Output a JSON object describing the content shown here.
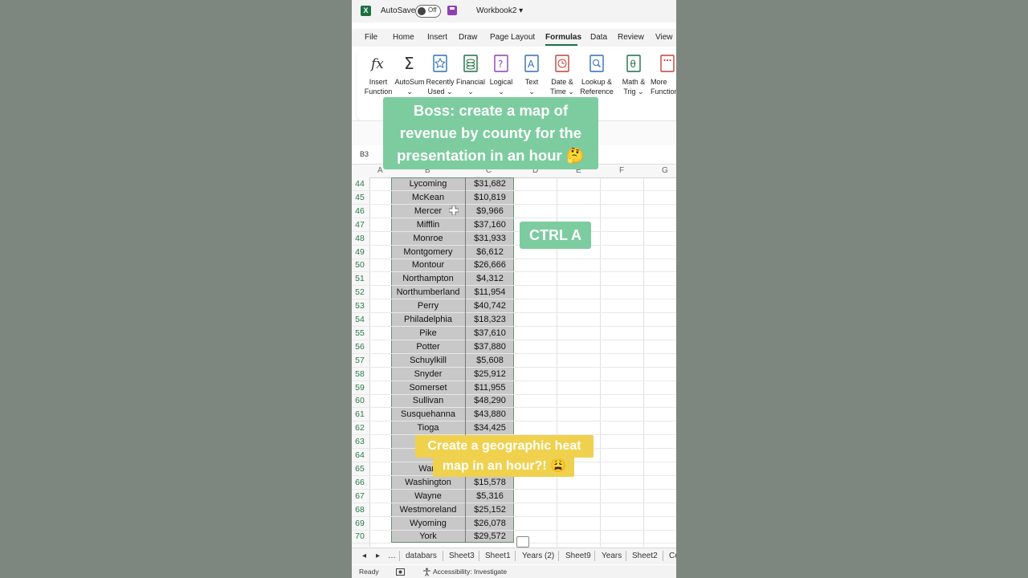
{
  "titlebar": {
    "logo": "X",
    "autosave_label": "AutoSave",
    "autosave_state": "Off",
    "workbook": "Workbook2 ▾"
  },
  "menu": [
    "File",
    "Home",
    "Insert",
    "Draw",
    "Page Layout",
    "Formulas",
    "Data",
    "Review",
    "View"
  ],
  "active_menu": "Formulas",
  "ribbon": {
    "insert_function": "Insert\nFunction",
    "autosum": "AutoSum\n⌄",
    "recently_used": "Recently\nUsed ⌄",
    "financial": "Financial\n⌄",
    "logical": "Logical\n⌄",
    "text": "Text\n⌄",
    "date_time": "Date &\nTime ⌄",
    "lookup": "Lookup &\nReference ⌄",
    "math_trig": "Math &\nTrig ⌄",
    "more": "More\nFunctions"
  },
  "name_box": "B3",
  "columns": [
    "A",
    "B",
    "C",
    "D",
    "E",
    "F",
    "G"
  ],
  "rows": [
    {
      "num": "44",
      "county": "Lycoming",
      "revenue": "$31,682"
    },
    {
      "num": "45",
      "county": "McKean",
      "revenue": "$10,819"
    },
    {
      "num": "46",
      "county": "Mercer",
      "revenue": "$9,966"
    },
    {
      "num": "47",
      "county": "Mifflin",
      "revenue": "$37,160"
    },
    {
      "num": "48",
      "county": "Monroe",
      "revenue": "$31,933"
    },
    {
      "num": "49",
      "county": "Montgomery",
      "revenue": "$6,612"
    },
    {
      "num": "50",
      "county": "Montour",
      "revenue": "$26,666"
    },
    {
      "num": "51",
      "county": "Northampton",
      "revenue": "$4,312"
    },
    {
      "num": "52",
      "county": "Northumberland",
      "revenue": "$11,954"
    },
    {
      "num": "53",
      "county": "Perry",
      "revenue": "$40,742"
    },
    {
      "num": "54",
      "county": "Philadelphia",
      "revenue": "$18,323"
    },
    {
      "num": "55",
      "county": "Pike",
      "revenue": "$37,610"
    },
    {
      "num": "56",
      "county": "Potter",
      "revenue": "$37,880"
    },
    {
      "num": "57",
      "county": "Schuylkill",
      "revenue": "$5,608"
    },
    {
      "num": "58",
      "county": "Snyder",
      "revenue": "$25,912"
    },
    {
      "num": "59",
      "county": "Somerset",
      "revenue": "$11,955"
    },
    {
      "num": "60",
      "county": "Sullivan",
      "revenue": "$48,290"
    },
    {
      "num": "61",
      "county": "Susquehanna",
      "revenue": "$43,880"
    },
    {
      "num": "62",
      "county": "Tioga",
      "revenue": "$34,425"
    },
    {
      "num": "63",
      "county": "",
      "revenue": ""
    },
    {
      "num": "64",
      "county": "V",
      "revenue": ""
    },
    {
      "num": "65",
      "county": "Warr",
      "revenue": ""
    },
    {
      "num": "66",
      "county": "Washington",
      "revenue": "$15,578"
    },
    {
      "num": "67",
      "county": "Wayne",
      "revenue": "$5,316"
    },
    {
      "num": "68",
      "county": "Westmoreland",
      "revenue": "$25,152"
    },
    {
      "num": "69",
      "county": "Wyoming",
      "revenue": "$26,078"
    },
    {
      "num": "70",
      "county": "York",
      "revenue": "$29,572"
    },
    {
      "num": "71",
      "county": "",
      "revenue": ""
    }
  ],
  "sheet_tabs": [
    "databars",
    "Sheet3",
    "Sheet1",
    "Years (2)",
    "Sheet9",
    "Years",
    "Sheet2",
    "Co"
  ],
  "tab_nav": {
    "prev": "◂",
    "next": "▸",
    "more": "…"
  },
  "status": {
    "ready": "Ready",
    "accessibility": "Accessibility: Investigate"
  },
  "overlays": {
    "boss_caption": "Boss: create a map of\nrevenue by county for the\npresentation in an hour 🤔",
    "ctrl_a": "CTRL A",
    "heat_map_caption": "Create a geographic heat\nmap in an hour?! 😩"
  },
  "colors": {
    "excel_green": "#1d6f42",
    "caption_green": "#7ccc9f",
    "caption_yellow": "#f0d14e",
    "row_number": "#2b7a4b"
  }
}
